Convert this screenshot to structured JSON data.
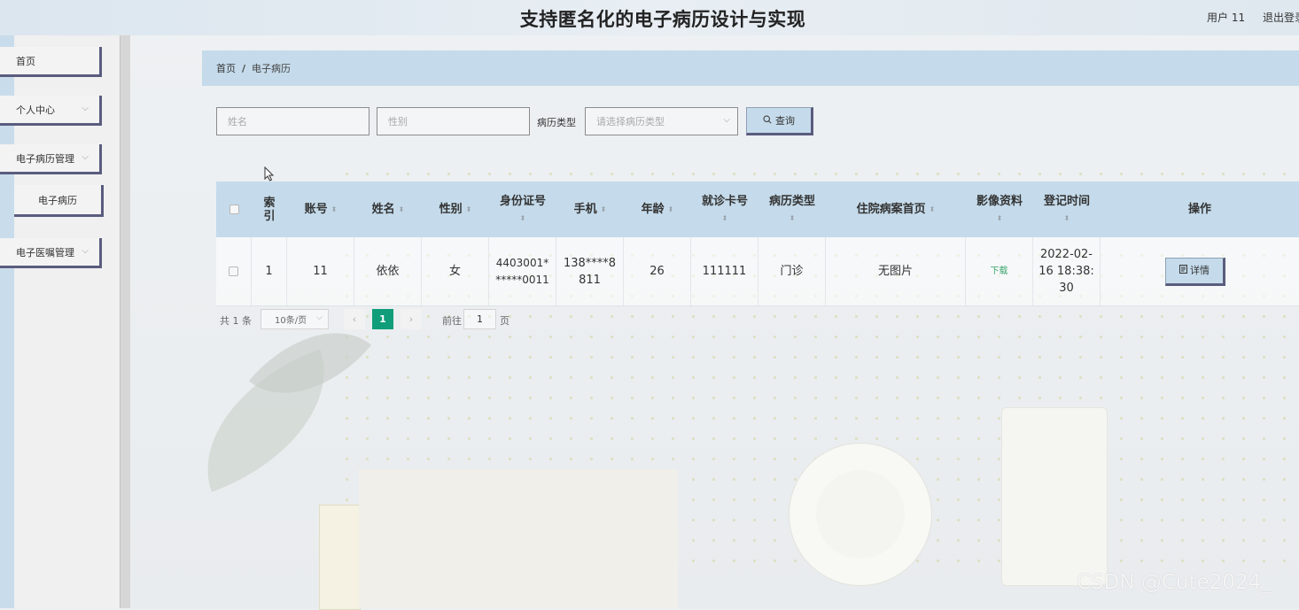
{
  "header": {
    "title": "支持匿名化的电子病历设计与实现",
    "user_label": "用户 11",
    "logout_label": "退出登录"
  },
  "sidebar": {
    "items": [
      {
        "label": "首页"
      },
      {
        "label": "个人中心"
      },
      {
        "label": "电子病历管理"
      },
      {
        "label": "电子病历"
      },
      {
        "label": "电子医嘱管理"
      }
    ]
  },
  "breadcrumb": {
    "home": "首页",
    "separator": "/",
    "current": "电子病历"
  },
  "search": {
    "name_placeholder": "姓名",
    "gender_placeholder": "性别",
    "type_label": "病历类型",
    "type_placeholder": "请选择病历类型",
    "query_label": "查询"
  },
  "table": {
    "headers": {
      "index": "索\n引",
      "account": "账号",
      "name": "姓名",
      "gender": "性别",
      "id_card": "身份证号",
      "phone": "手机",
      "age": "年龄",
      "card_no": "就诊卡号",
      "record_type": "病历类型",
      "front_page": "住院病案首页",
      "images": "影像资料",
      "reg_time": "登记时间",
      "actions": "操作"
    },
    "rows": [
      {
        "index": "1",
        "account": "11",
        "name": "依依",
        "gender": "女",
        "id_card": "4403001*\n*****0011",
        "phone": "138****8\n811",
        "age": "26",
        "card_no": "111111",
        "record_type": "门诊",
        "front_page": "无图片",
        "images": "下载",
        "reg_time": "2022-02-\n16 18:38:\n30",
        "detail_label": "详情"
      }
    ]
  },
  "pagination": {
    "total": "共 1 条",
    "page_size": "10条/页",
    "prev": "‹",
    "current": "1",
    "next": "›",
    "goto_label": "前往",
    "goto_value": "1",
    "page_suffix": "页"
  },
  "watermark": "CSDN @Cute2024_",
  "colors": {
    "accent_blue": "#c5dbeb",
    "button_border": "#5a5c7e",
    "page_active": "#0f9d7a",
    "download_link": "#3aa56c"
  },
  "icons": [
    "chevron-down-icon",
    "search-icon",
    "document-icon",
    "checkbox-icon",
    "sort-icon"
  ]
}
